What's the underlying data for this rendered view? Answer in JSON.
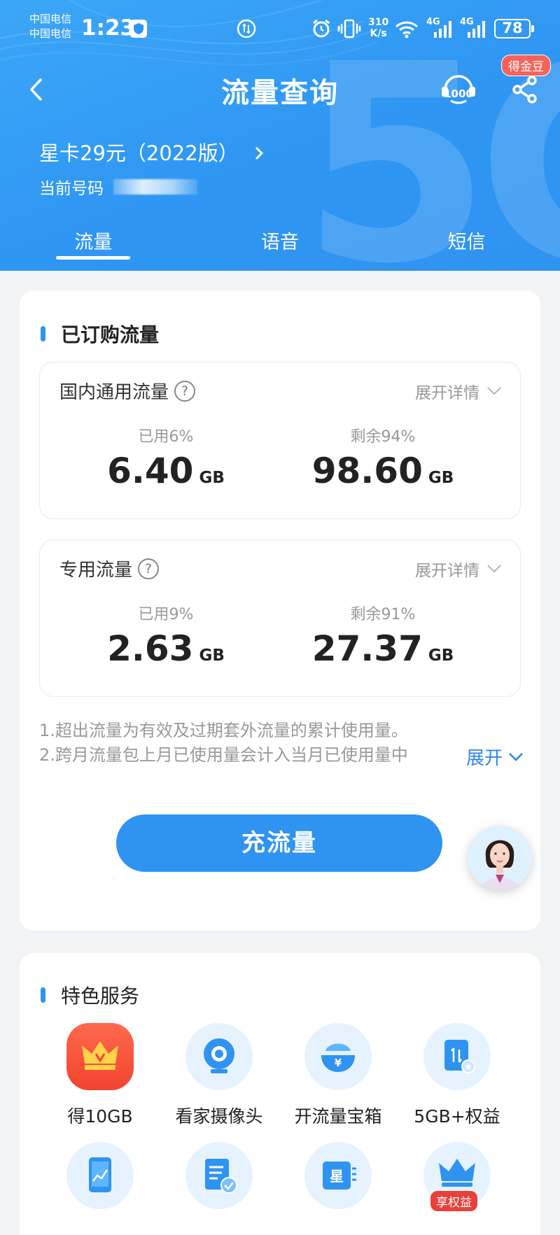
{
  "status_bar": {
    "carrier_1": "中国电信",
    "carrier_2": "中国电信",
    "time": "1:23",
    "speed_value": "310",
    "speed_unit": "K/s",
    "network_1": "4G",
    "network_2": "4G",
    "battery": "78"
  },
  "header": {
    "title": "流量查询",
    "service_icon": "10000-service-icon",
    "coin_badge": "得金豆",
    "plan_name": "星卡29元（2022版）",
    "phone_label": "当前号码"
  },
  "tabs": [
    {
      "label": "流量",
      "active": true
    },
    {
      "label": "语音",
      "active": false
    },
    {
      "label": "短信",
      "active": false
    }
  ],
  "subscribed": {
    "title": "已订购流量",
    "items": [
      {
        "name": "国内通用流量",
        "expand": "展开详情",
        "used_label": "已用6%",
        "used_value": "6.40",
        "remain_label": "剩余94%",
        "remain_value": "98.60",
        "unit": "GB"
      },
      {
        "name": "专用流量",
        "expand": "展开详情",
        "used_label": "已用9%",
        "used_value": "2.63",
        "remain_label": "剩余91%",
        "remain_value": "27.37",
        "unit": "GB"
      }
    ],
    "note_1": "1.超出流量为有效及过期套外流量的累计使用量。",
    "note_2": "2.跨月流量包上月已使用量会计入当月已使用量中",
    "note_expand": "展开",
    "recharge": "充流量"
  },
  "services": {
    "title": "特色服务",
    "items": [
      {
        "label": "得10GB",
        "icon": "crown-icon"
      },
      {
        "label": "看家摄像头",
        "icon": "camera-icon"
      },
      {
        "label": "开流量宝箱",
        "icon": "treasure-box-icon"
      },
      {
        "label": "5GB+权益",
        "icon": "data-card-icon"
      },
      {
        "label": "",
        "icon": "phone-chart-icon"
      },
      {
        "label": "",
        "icon": "document-check-icon"
      },
      {
        "label": "",
        "icon": "star-card-icon"
      },
      {
        "label": "",
        "icon": "vip-crown-icon",
        "tag": "享权益"
      }
    ]
  },
  "colors": {
    "brand_blue": "#2f93f1",
    "link_blue": "#2f86e8",
    "badge_red": "#f5645a"
  }
}
